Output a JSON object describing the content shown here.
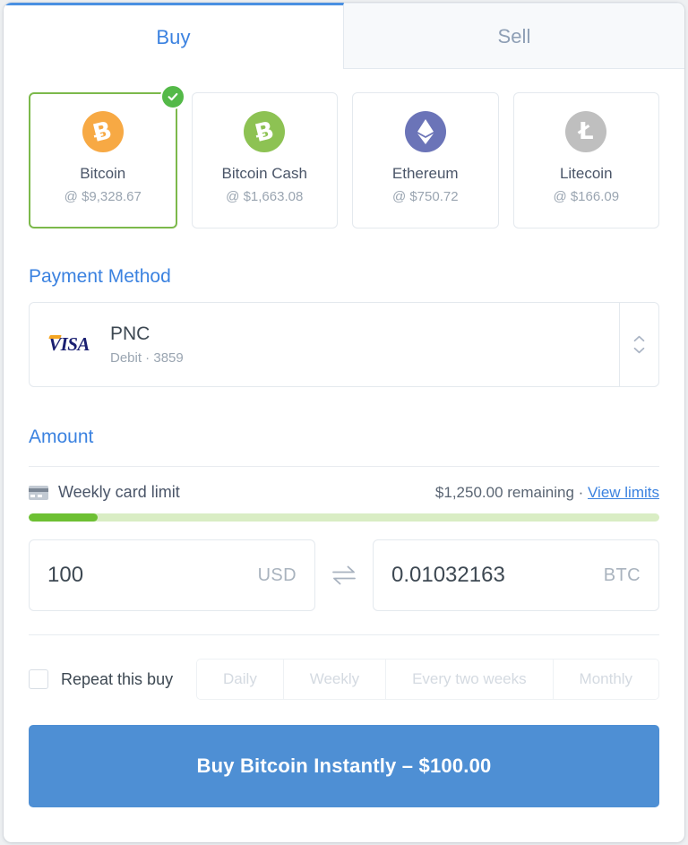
{
  "tabs": [
    {
      "label": "Buy",
      "active": true
    },
    {
      "label": "Sell",
      "active": false
    }
  ],
  "cryptos": [
    {
      "name": "Bitcoin",
      "price": "@ $9,328.67",
      "symbol": "Ƀ",
      "selected": true
    },
    {
      "name": "Bitcoin Cash",
      "price": "@ $1,663.08",
      "symbol": "Ƀ",
      "selected": false
    },
    {
      "name": "Ethereum",
      "price": "@ $750.72",
      "symbol": "",
      "selected": false
    },
    {
      "name": "Litecoin",
      "price": "@ $166.09",
      "symbol": "Ł",
      "selected": false
    }
  ],
  "payment": {
    "heading": "Payment Method",
    "brand": "VISA",
    "name": "PNC",
    "details": "Debit · 3859"
  },
  "amount": {
    "heading": "Amount",
    "limit_label": "Weekly card limit",
    "remaining": "$1,250.00 remaining · ",
    "view_limits": "View limits",
    "progress_percent": 11,
    "fiat_value": "100",
    "fiat_unit": "USD",
    "crypto_value": "0.01032163",
    "crypto_unit": "BTC"
  },
  "repeat": {
    "label": "Repeat this buy",
    "checked": false,
    "frequencies": [
      "Daily",
      "Weekly",
      "Every two weeks",
      "Monthly"
    ]
  },
  "cta": {
    "label": "Buy Bitcoin Instantly – $100.00"
  },
  "colors": {
    "accent_blue": "#3b82e0",
    "cta_blue": "#4e8fd4",
    "selected_green": "#7cb94b",
    "progress_green": "#6dc033",
    "btc_orange": "#f7a944",
    "bch_green": "#8dc253",
    "eth_purple": "#6b74b8",
    "ltc_gray": "#bfbfbf"
  }
}
